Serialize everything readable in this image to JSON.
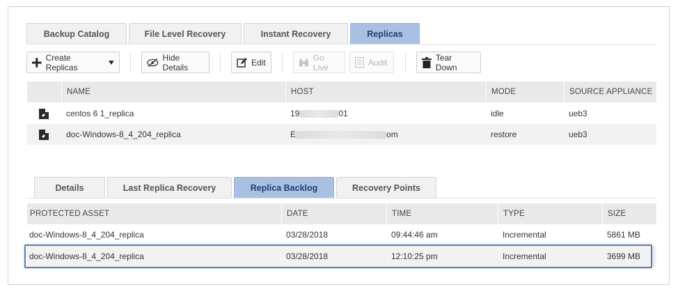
{
  "top_tabs": [
    {
      "label": "Backup Catalog",
      "active": false
    },
    {
      "label": "File Level Recovery",
      "active": false
    },
    {
      "label": "Instant Recovery",
      "active": false
    },
    {
      "label": "Replicas",
      "active": true
    }
  ],
  "toolbar": {
    "create_replicas": "Create Replicas",
    "hide_details": "Hide Details",
    "edit": "Edit",
    "go_live": "Go Live",
    "audit": "Audit",
    "tear_down": "Tear Down"
  },
  "replicas_table": {
    "columns": [
      "NAME",
      "HOST",
      "MODE",
      "SOURCE APPLIANCE"
    ],
    "rows": [
      {
        "name": "centos 6 1_replica",
        "host_prefix": "19",
        "host_suffix": "01",
        "mode": "idle",
        "source": "ueb3"
      },
      {
        "name": "doc-Windows-8_4_204_replica",
        "host_prefix": "E",
        "host_suffix": "om",
        "mode": "restore",
        "source": "ueb3"
      }
    ]
  },
  "bottom_tabs": [
    {
      "label": "Details",
      "active": false
    },
    {
      "label": "Last Replica Recovery",
      "active": false
    },
    {
      "label": "Replica Backlog",
      "active": true
    },
    {
      "label": "Recovery Points",
      "active": false
    }
  ],
  "backlog_table": {
    "columns": [
      "PROTECTED ASSET",
      "DATE",
      "TIME",
      "TYPE",
      "SIZE"
    ],
    "rows": [
      {
        "asset": "doc-Windows-8_4_204_replica",
        "date": "03/28/2018",
        "time": "09:44:46 am",
        "type": "Incremental",
        "size": "5861 MB"
      },
      {
        "asset": "doc-Windows-8_4_204_replica",
        "date": "03/28/2018",
        "time": "12:10:25 pm",
        "type": "Incremental",
        "size": "3699 MB"
      }
    ]
  },
  "colors": {
    "active_tab": "#a9c0e3",
    "highlight_border": "#5b7fae"
  }
}
